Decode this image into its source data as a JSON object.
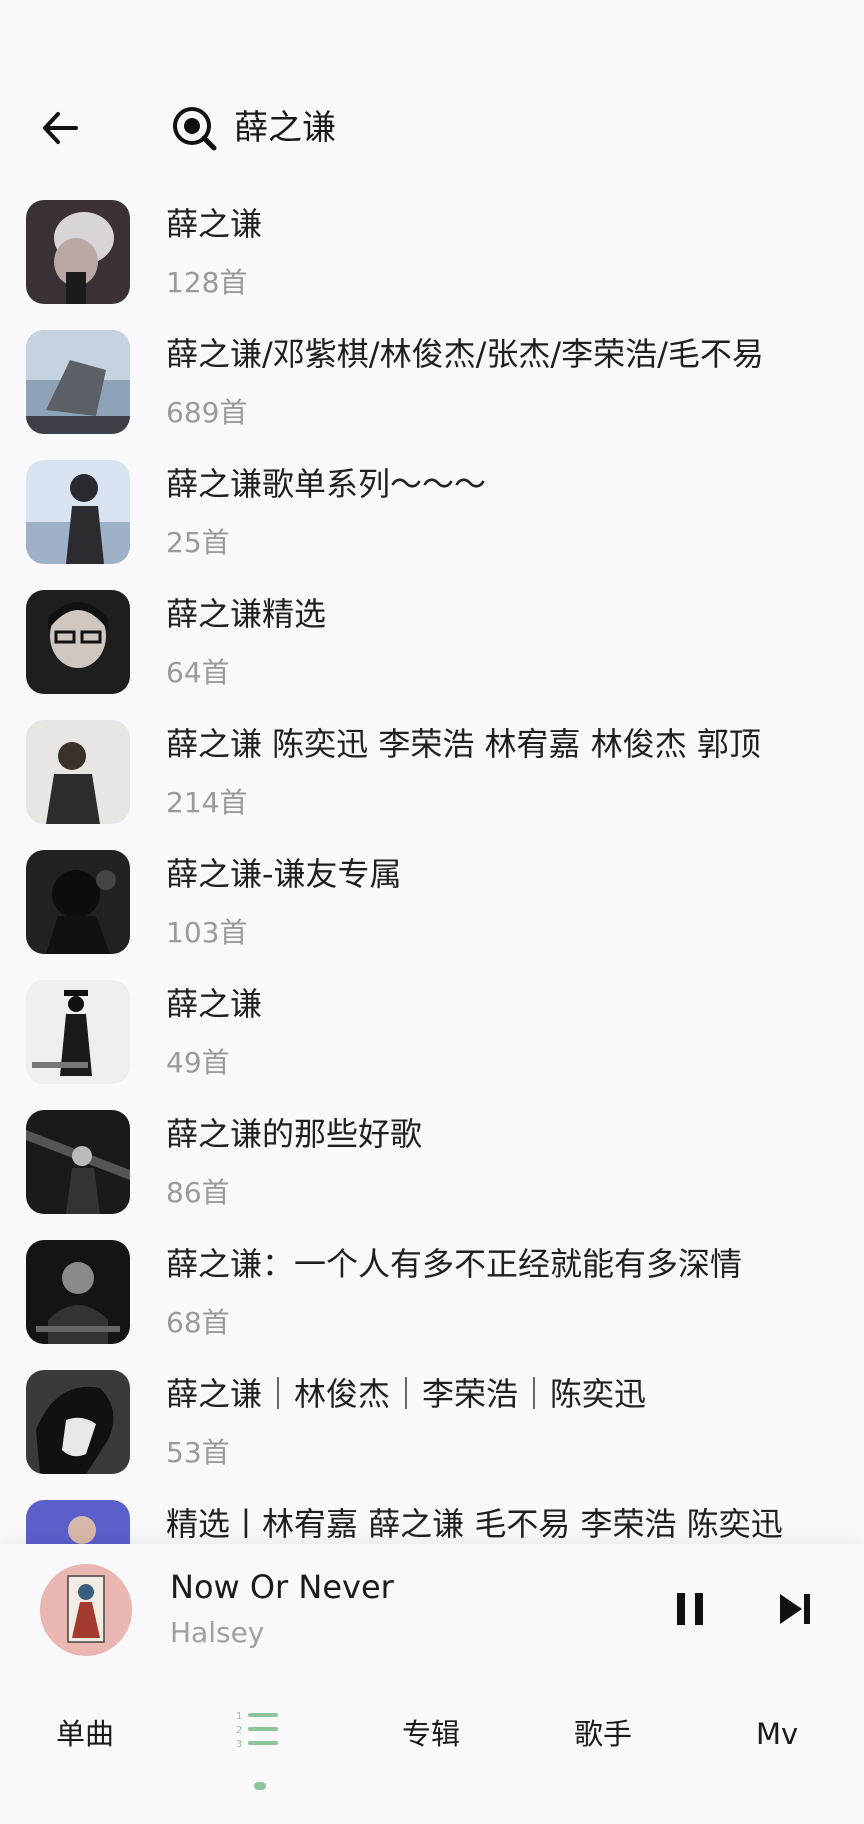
{
  "header": {
    "query": "薛之谦"
  },
  "results": [
    {
      "title": "薛之谦",
      "count": "128首"
    },
    {
      "title": "薛之谦/邓紫棋/林俊杰/张杰/李荣浩/毛不易",
      "count": "689首"
    },
    {
      "title": "薛之谦歌单系列～～～",
      "count": "25首"
    },
    {
      "title": "薛之谦精选",
      "count": "64首"
    },
    {
      "title": "薛之谦 陈奕迅 李荣浩 林宥嘉 林俊杰 郭顶",
      "count": "214首"
    },
    {
      "title": "薛之谦-谦友专属",
      "count": "103首"
    },
    {
      "title": "薛之谦",
      "count": "49首"
    },
    {
      "title": "薛之谦的那些好歌",
      "count": "86首"
    },
    {
      "title": "薛之谦：一个人有多不正经就能有多深情",
      "count": "68首"
    },
    {
      "title": "薛之谦｜林俊杰｜李荣浩｜陈奕迅",
      "count": "53首"
    },
    {
      "title": "精选丨林宥嘉 薛之谦 毛不易 李荣浩 陈奕迅",
      "count": ""
    }
  ],
  "player": {
    "song": "Now Or Never",
    "artist": "Halsey"
  },
  "tabs": {
    "single": "单曲",
    "album": "专辑",
    "singer": "歌手",
    "mv": "Mv"
  },
  "colors": {
    "accent": "#8fc49a",
    "muted": "#9a9a9a"
  }
}
